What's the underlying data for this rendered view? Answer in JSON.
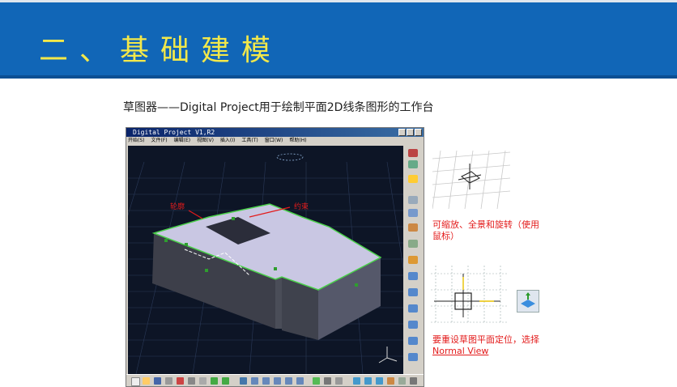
{
  "slide": {
    "title": "二、基础建模",
    "subtitle": "草图器——Digital Project用于绘制平面2D线条图形的工作台"
  },
  "app": {
    "window_title": "Digital Project V1,R2",
    "menu": [
      "开始(S)",
      "文件(F)",
      "编辑(E)",
      "视图(V)",
      "插入(I)",
      "工具(T)",
      "窗口(W)",
      "帮助(H)"
    ]
  },
  "viewport": {
    "label_left": "轮廓",
    "label_right": "约束"
  },
  "notes": {
    "zoom_text": "可缩放、全景和旋转（使用鼠标）",
    "reset_text": "要重设草图平面定位，选择",
    "reset_link": "Normal View"
  },
  "colors": {
    "header_bg": "#1166b7",
    "title_color": "#f3e84a",
    "note_color": "#e31b1b",
    "viewport_bg": "#0d1526"
  }
}
